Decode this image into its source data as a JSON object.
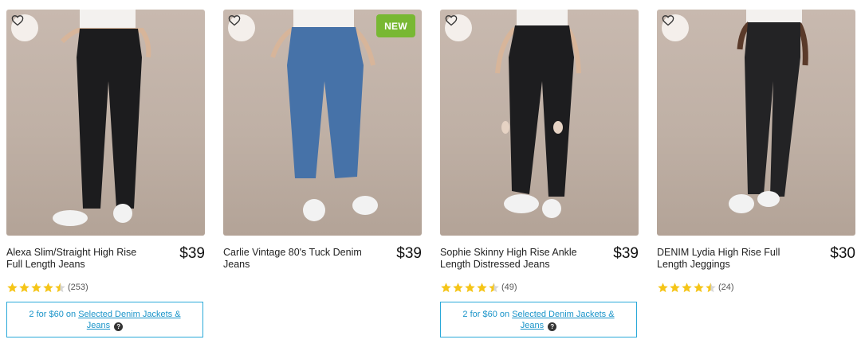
{
  "products": [
    {
      "title": "Alexa Slim/Straight High Rise Full Length Jeans",
      "price": "$39",
      "rating": 4.5,
      "review_count": "(253)",
      "badge": "",
      "promo": {
        "prefix": "2 for $60 on ",
        "link": "Selected Denim Jackets & Jeans",
        "help_icon": "?"
      }
    },
    {
      "title": "Carlie Vintage 80's Tuck Denim Jeans",
      "price": "$39",
      "badge": "NEW"
    },
    {
      "title": "Sophie Skinny High Rise Ankle Length Distressed Jeans",
      "price": "$39",
      "rating": 4.5,
      "review_count": "(49)",
      "badge": "",
      "promo": {
        "prefix": "2 for $60 on ",
        "link": "Selected Denim Jackets & Jeans",
        "help_icon": "?"
      }
    },
    {
      "title": "DENIM Lydia High Rise Full Length Jeggings",
      "price": "$30",
      "rating": 4.5,
      "review_count": "(24)",
      "badge": ""
    }
  ],
  "icons": {
    "wishlist": "heart-outline-icon",
    "star": "star-icon",
    "help": "question-circle-icon"
  },
  "colors": {
    "star": "#f5c518",
    "star_empty": "#d6d6d6",
    "badge_new": "#78b833",
    "promo_border": "#2aa9d9",
    "promo_text": "#1a94c9"
  }
}
